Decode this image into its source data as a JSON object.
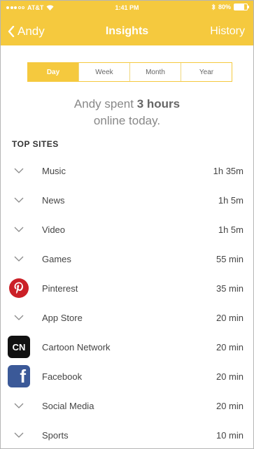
{
  "status": {
    "carrier": "AT&T",
    "time": "1:41 PM",
    "battery": "80%",
    "battery_level": 0.8
  },
  "nav": {
    "back_label": "Andy",
    "title": "Insights",
    "history_label": "History"
  },
  "segments": {
    "day": "Day",
    "week": "Week",
    "month": "Month",
    "year": "Year",
    "selected": "Day"
  },
  "summary": {
    "line1_prefix": "Andy spent ",
    "line1_bold": "3 hours",
    "line2": "online today."
  },
  "top_sites": {
    "title": "TOP SITES",
    "items": [
      {
        "icon": "chevron-down-icon",
        "name": "Music",
        "time": "1h 35m"
      },
      {
        "icon": "chevron-down-icon",
        "name": "News",
        "time": "1h 5m"
      },
      {
        "icon": "chevron-down-icon",
        "name": "Video",
        "time": "1h 5m"
      },
      {
        "icon": "chevron-down-icon",
        "name": "Games",
        "time": "55 min"
      },
      {
        "icon": "pinterest-icon",
        "name": "Pinterest",
        "time": "35 min"
      },
      {
        "icon": "chevron-down-icon",
        "name": "App Store",
        "time": "20 min"
      },
      {
        "icon": "cartoon-network-icon",
        "name": "Cartoon Network",
        "time": "20 min"
      },
      {
        "icon": "facebook-icon",
        "name": "Facebook",
        "time": "20 min"
      },
      {
        "icon": "chevron-down-icon",
        "name": "Social Media",
        "time": "20 min"
      },
      {
        "icon": "chevron-down-icon",
        "name": "Sports",
        "time": "10 min"
      }
    ]
  },
  "icon_labels": {
    "cartoon_network": "CN",
    "facebook": "f"
  },
  "colors": {
    "accent": "#f5c93e",
    "pinterest": "#cb2027",
    "facebook": "#3b5998"
  }
}
